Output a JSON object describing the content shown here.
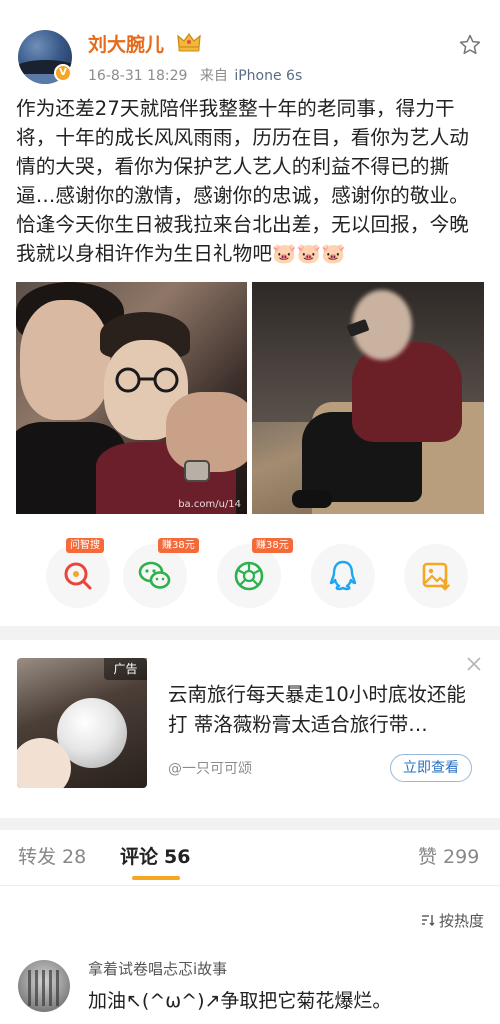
{
  "post": {
    "username": "刘大腕儿",
    "date": "16-8-31 18:29",
    "source_prefix": "来自",
    "device": "iPhone 6s",
    "text": "作为还差27天就陪伴我整整十年的老同事，得力干将，十年的成长风风雨雨，历历在目，看你为艺人动情的大哭，看你为保护艺人艺人的利益不得已的撕逼…感谢你的激情，感谢你的忠诚，感谢你的敬业。恰逢今天你生日被我拉来台北出差，无以回报，今晚我就以身相许作为生日礼物吧🐷🐷🐷",
    "photo_watermark": "ba.com/u/14"
  },
  "icons": {
    "verified": "verified-badge-icon",
    "crown": "crown-icon",
    "favorite": "star-icon"
  },
  "actions": [
    {
      "name": "search-insight",
      "icon": "search-icon",
      "tag": "问智搜"
    },
    {
      "name": "wechat",
      "icon": "wechat-icon",
      "tag": "赚38元"
    },
    {
      "name": "moments",
      "icon": "moments-icon",
      "tag": "赚38元"
    },
    {
      "name": "qq",
      "icon": "qq-icon",
      "tag": ""
    },
    {
      "name": "save-image",
      "icon": "image-save-icon",
      "tag": ""
    }
  ],
  "ad": {
    "badge": "广告",
    "title": "云南旅行每天暴走10小时底妆还能打 蒂洛薇粉膏太适合旅行带…",
    "author": "@一只可可颂",
    "cta": "立即查看"
  },
  "tabs": {
    "repost_label": "转发",
    "repost_count": "28",
    "comment_label": "评论",
    "comment_count": "56",
    "like_label": "赞",
    "like_count": "299"
  },
  "sort_label": "按热度",
  "comment": {
    "name": "拿着试卷唱忐忑i故事",
    "text": "加油↖(^ω^)↗争取把它菊花爆烂。"
  },
  "colors": {
    "username": "#e66a1a",
    "accent_underline": "#f5a623",
    "tag_bg": "#f56a3a",
    "cta": "#2a70c4"
  }
}
